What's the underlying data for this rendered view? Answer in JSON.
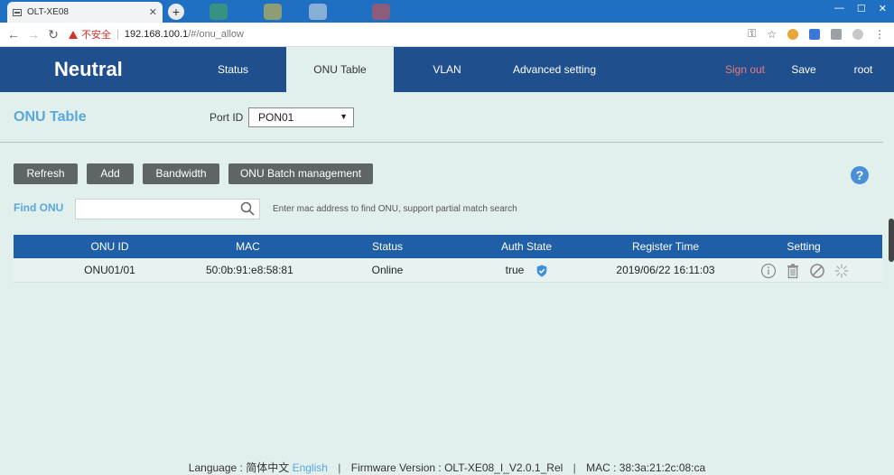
{
  "browser": {
    "tab_title": "OLT-XE08",
    "tab_close": "✕",
    "new_tab": "+",
    "insecure_label": "不安全",
    "url_host": "192.168.100.1",
    "url_path": "/#/onu_allow",
    "win_min": "—",
    "win_max": "☐",
    "win_close": "✕"
  },
  "app": {
    "brand": "Neutral",
    "nav": {
      "status": "Status",
      "onu_table": "ONU Table",
      "vlan": "VLAN",
      "advanced": "Advanced setting",
      "sign_out": "Sign out",
      "save": "Save",
      "user": "root"
    },
    "page_title": "ONU Table",
    "port": {
      "label": "Port ID",
      "selected": "PON01"
    },
    "buttons": {
      "refresh": "Refresh",
      "add": "Add",
      "bandwidth": "Bandwidth",
      "batch": "ONU Batch management"
    },
    "help": "?",
    "find": {
      "label": "Find ONU",
      "value": "",
      "placeholder": "",
      "hint": "Enter mac address to find ONU, support partial match search"
    },
    "table": {
      "headers": {
        "onu_id": "ONU ID",
        "mac": "MAC",
        "status": "Status",
        "auth_state": "Auth State",
        "register_time": "Register Time",
        "setting": "Setting"
      },
      "rows": [
        {
          "onu_id": "ONU01/01",
          "mac": "50:0b:91:e8:58:81",
          "status": "Online",
          "auth_state": "true",
          "register_time": "2019/06/22 16:11:03"
        }
      ]
    },
    "footer": {
      "language_label": "Language :",
      "lang_cn": "简体中文",
      "lang_en": "English",
      "sep": "|",
      "firmware": "Firmware Version : OLT-XE08_I_V2.0.1_Rel",
      "mac": "MAC : 38:3a:21:2c:08:ca"
    }
  },
  "colors": {
    "nav_bg": "#1f4f8c",
    "page_bg": "#e2f0ed",
    "accent": "#5aa7dc",
    "table_head": "#1f5fa8",
    "button": "#5f6466",
    "sign_out": "#e57c7c"
  },
  "icons": {
    "row_actions": [
      "info-icon",
      "trash-icon",
      "disable-icon",
      "reset-icon"
    ],
    "auth_verified": "shield-check-icon",
    "search": "search-icon"
  }
}
